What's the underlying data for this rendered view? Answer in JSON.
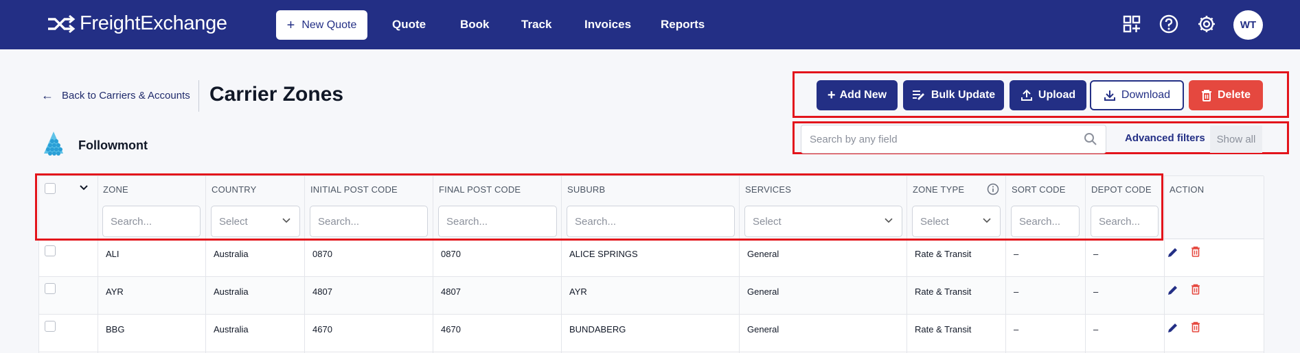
{
  "app": {
    "brand": "FreightExchange"
  },
  "nav": {
    "new_quote": "New Quote",
    "links": [
      "Quote",
      "Book",
      "Track",
      "Invoices",
      "Reports"
    ],
    "avatar_initials": "WT"
  },
  "header": {
    "back_label": "Back to Carriers & Accounts",
    "title": "Carrier Zones",
    "carrier_name": "Followmont"
  },
  "actions": {
    "add_new": "Add New",
    "bulk_update": "Bulk Update",
    "upload": "Upload",
    "download": "Download",
    "delete": "Delete"
  },
  "search": {
    "placeholder": "Search by any field",
    "advanced_filters": "Advanced filters",
    "show_all": "Show all"
  },
  "table": {
    "columns": [
      "ZONE",
      "COUNTRY",
      "INITIAL POST CODE",
      "FINAL POST CODE",
      "SUBURB",
      "SERVICES",
      "ZONE TYPE",
      "SORT CODE",
      "DEPOT CODE",
      "ACTION"
    ],
    "filters": {
      "zone": "Search...",
      "country": "Select",
      "initial_post_code": "Search...",
      "final_post_code": "Search...",
      "suburb": "Search...",
      "services": "Select",
      "zone_type": "Select",
      "sort_code": "Search...",
      "depot_code": "Search..."
    },
    "rows": [
      {
        "zone": "ALI",
        "country": "Australia",
        "initial": "0870",
        "final": "0870",
        "suburb": "ALICE SPRINGS",
        "services": "General",
        "zone_type": "Rate & Transit",
        "sort_code": "–",
        "depot_code": "–"
      },
      {
        "zone": "AYR",
        "country": "Australia",
        "initial": "4807",
        "final": "4807",
        "suburb": "AYR",
        "services": "General",
        "zone_type": "Rate & Transit",
        "sort_code": "–",
        "depot_code": "–"
      },
      {
        "zone": "BBG",
        "country": "Australia",
        "initial": "4670",
        "final": "4670",
        "suburb": "BUNDABERG",
        "services": "General",
        "zone_type": "Rate & Transit",
        "sort_code": "–",
        "depot_code": "–"
      }
    ]
  },
  "colors": {
    "nav_bg": "#232f85",
    "primary": "#232f85",
    "danger": "#e5483f",
    "highlight": "#e3141b"
  }
}
